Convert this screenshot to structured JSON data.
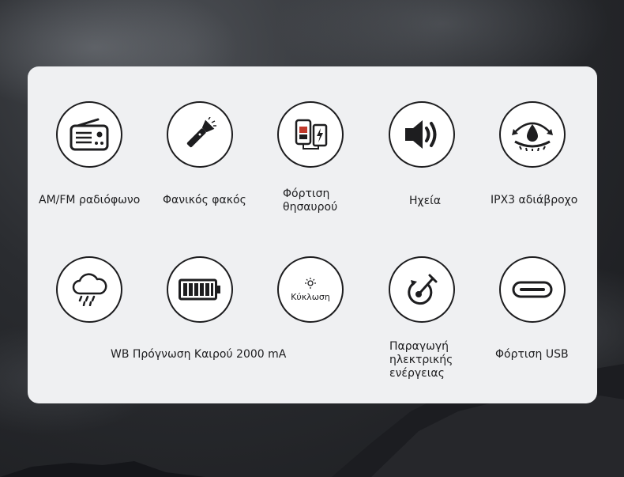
{
  "row1": [
    {
      "icon": "radio-icon",
      "label": "AM/FM ραδιόφωνο"
    },
    {
      "icon": "flashlight-icon",
      "label": "Φανικός φακός"
    },
    {
      "icon": "power-bank-icon",
      "label": "Φόρτιση\nθησαυρού"
    },
    {
      "icon": "speaker-icon",
      "label": "Ηχεία"
    },
    {
      "icon": "waterproof-icon",
      "label": "IPX3 αδιάβροχο"
    }
  ],
  "row2": [
    {
      "icon": "cloud-rain-icon"
    },
    {
      "icon": "battery-icon"
    },
    {
      "icon": "sun-icon",
      "inner_label": "Κύκλωση"
    },
    {
      "icon": "hand-crank-icon",
      "label": "Παραγωγή\nηλεκτρικής\nενέργειας"
    },
    {
      "icon": "usb-c-icon",
      "label": "Φόρτιση USB"
    }
  ],
  "row2_shared_label": "WB Πρόγνωση Καιρού 2000 mA"
}
